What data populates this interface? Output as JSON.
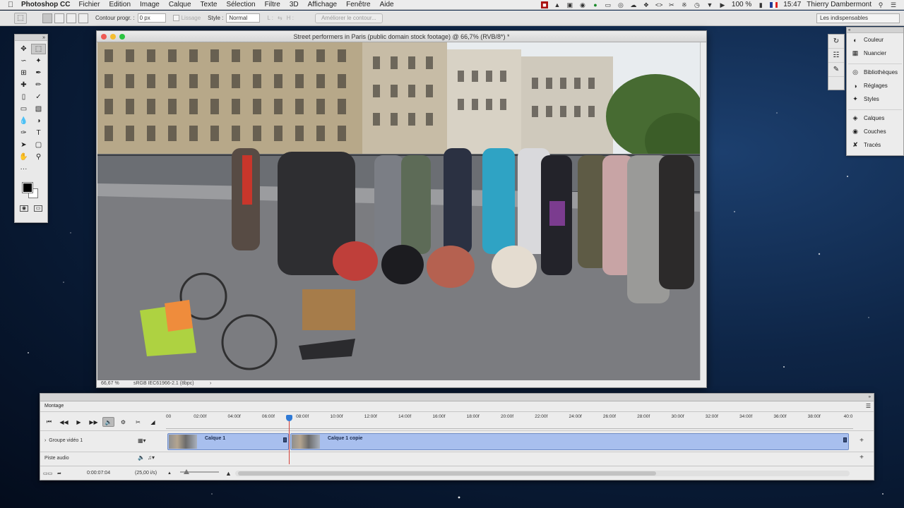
{
  "menubar": {
    "app_name": "Photoshop CC",
    "menus": [
      "Fichier",
      "Edition",
      "Image",
      "Calque",
      "Texte",
      "Sélection",
      "Filtre",
      "3D",
      "Affichage",
      "Fenêtre",
      "Aide"
    ],
    "battery": "100 %",
    "time": "15:47",
    "user": "Thierry Dambermont"
  },
  "options_bar": {
    "feather_label": "Contour progr. :",
    "feather_value": "0 px",
    "antialias_label": "Lissage",
    "style_label": "Style :",
    "style_value": "Normal",
    "width_label": "L :",
    "height_label": "H :",
    "refine_button": "Améliorer le contour...",
    "workspace": "Les indispensables"
  },
  "document": {
    "title": "Street performers in Paris (public domain stock footage) @ 66,7% (RVB/8*) *",
    "zoom": "66,67 %",
    "profile": "sRGB IEC61966-2.1 (8bpc)"
  },
  "panels": {
    "items": [
      {
        "label": "Couleur",
        "icon": "color-wheel-icon"
      },
      {
        "label": "Nuancier",
        "icon": "swatches-grid-icon"
      },
      {
        "label": "Bibliothèques",
        "icon": "libraries-icon"
      },
      {
        "label": "Réglages",
        "icon": "adjustments-icon"
      },
      {
        "label": "Styles",
        "icon": "styles-icon"
      },
      {
        "label": "Calques",
        "icon": "layers-icon"
      },
      {
        "label": "Couches",
        "icon": "channels-icon"
      },
      {
        "label": "Tracés",
        "icon": "paths-icon"
      }
    ]
  },
  "timeline": {
    "tab_label": "Montage",
    "ruler_labels": [
      "00",
      "02:00f",
      "04:00f",
      "06:00f",
      "08:00f",
      "10:00f",
      "12:00f",
      "14:00f",
      "16:00f",
      "18:00f",
      "20:00f",
      "22:00f",
      "24:00f",
      "26:00f",
      "28:00f",
      "30:00f",
      "32:00f",
      "34:00f",
      "36:00f",
      "38:00f",
      "40:0"
    ],
    "video_group_label": "Groupe vidéo 1",
    "audio_track_label": "Piste audio",
    "clips": [
      {
        "name": "Calque 1"
      },
      {
        "name": "Calque 1 copie"
      }
    ],
    "timecode": "0:00:07:04",
    "fps": "(25,00 i/s)"
  },
  "colors": {
    "clip_fill": "#a8bfee",
    "playhead": "#d4413a",
    "foreground_color": "#000000",
    "background_color": "#ffffff"
  }
}
